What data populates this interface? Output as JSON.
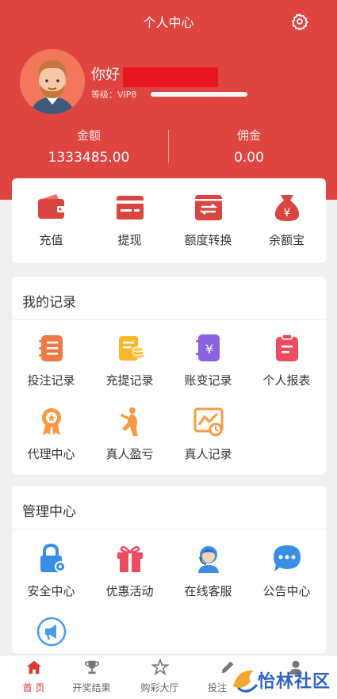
{
  "header": {
    "title": "个人中心"
  },
  "user": {
    "greeting": "你好",
    "level_label": "等级：VIP8"
  },
  "stats": {
    "amount_label": "金额",
    "amount_value": "1333485.00",
    "commission_label": "佣金",
    "commission_value": "0.00"
  },
  "quick_actions": [
    {
      "label": "充值",
      "icon": "wallet-icon"
    },
    {
      "label": "提现",
      "icon": "card-icon"
    },
    {
      "label": "额度转换",
      "icon": "transfer-icon"
    },
    {
      "label": "余额宝",
      "icon": "money-bag-icon"
    }
  ],
  "records": {
    "title": "我的记录",
    "items": [
      {
        "label": "投注记录",
        "icon": "bet-record-icon"
      },
      {
        "label": "充提记录",
        "icon": "coin-clipboard-icon"
      },
      {
        "label": "账变记录",
        "icon": "yen-book-icon"
      },
      {
        "label": "个人报表",
        "icon": "report-icon"
      },
      {
        "label": "代理中心",
        "icon": "medal-icon"
      },
      {
        "label": "真人盈亏",
        "icon": "dancer-icon"
      },
      {
        "label": "真人记录",
        "icon": "chart-clock-icon"
      }
    ]
  },
  "management": {
    "title": "管理中心",
    "items": [
      {
        "label": "安全中心",
        "icon": "lock-gear-icon"
      },
      {
        "label": "优惠活动",
        "icon": "gift-icon"
      },
      {
        "label": "在线客服",
        "icon": "headset-agent-icon"
      },
      {
        "label": "公告中心",
        "icon": "chat-bubble-icon"
      },
      {
        "label": "",
        "icon": "megaphone-icon"
      }
    ]
  },
  "tabbar": [
    {
      "label": "首 页",
      "icon": "home-icon",
      "active": true
    },
    {
      "label": "开奖结果",
      "icon": "trophy-icon",
      "active": false
    },
    {
      "label": "购彩大厅",
      "icon": "star-icon",
      "active": false
    },
    {
      "label": "投注",
      "icon": "pencil-icon",
      "active": false
    },
    {
      "label": "",
      "icon": "user-icon",
      "active": false
    }
  ],
  "watermark": {
    "text": "怡林社区"
  },
  "colors": {
    "primary": "#de4440",
    "accent_blue": "#3a8ee6"
  }
}
